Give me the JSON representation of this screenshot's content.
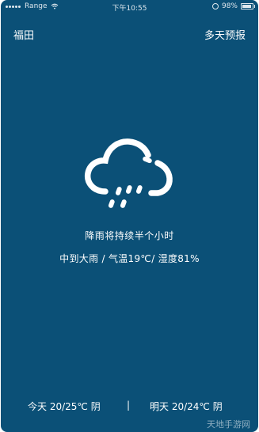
{
  "status_bar": {
    "carrier": "Range",
    "time": "下午10:55",
    "battery": "98%"
  },
  "header": {
    "city": "福田",
    "forecast_link": "多天预报"
  },
  "current": {
    "icon": "rain-cloud-icon",
    "description": "降雨将持续半个小时",
    "detail": "中到大雨 / 气温19℃/ 湿度81%"
  },
  "footer": {
    "today": "今天  20/25℃ 阴",
    "divider": "|",
    "tomorrow": "明天  20/24℃ 阴"
  },
  "watermark": "天地手游网",
  "colors": {
    "background": "#0b5077",
    "text": "#ffffff"
  }
}
